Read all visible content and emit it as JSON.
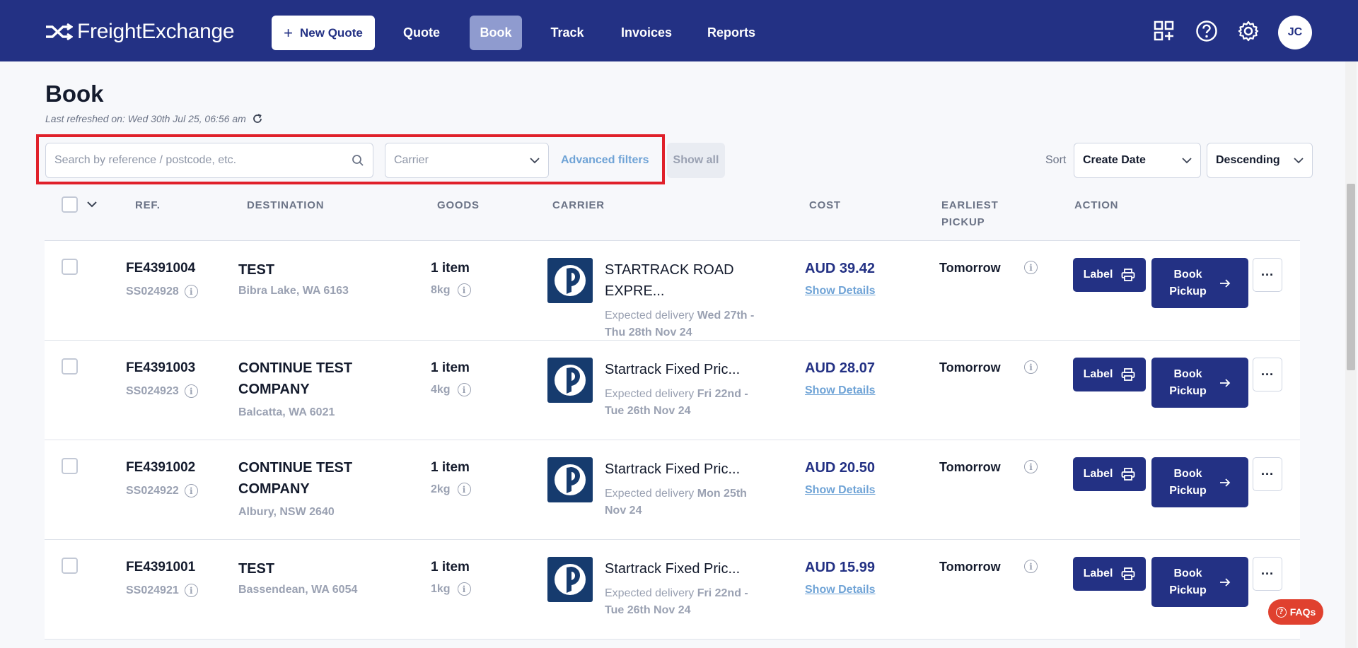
{
  "app": {
    "logo_text": "FreightExchange",
    "user_initials": "JC"
  },
  "nav": {
    "new_quote": "New Quote",
    "items": [
      "Quote",
      "Book",
      "Track",
      "Invoices",
      "Reports"
    ],
    "active": "Book"
  },
  "header": {
    "title": "Book",
    "refreshed": "Last refreshed on: Wed 30th Jul 25, 06:56 am"
  },
  "filters": {
    "search_placeholder": "Search by reference / postcode, etc.",
    "carrier_placeholder": "Carrier",
    "advanced": "Advanced filters",
    "show_all": "Show all",
    "sort_label": "Sort",
    "sort_by": "Create Date",
    "sort_order": "Descending"
  },
  "table": {
    "columns": [
      "REF.",
      "DESTINATION",
      "GOODS",
      "CARRIER",
      "COST",
      "EARLIEST",
      "PICKUP",
      "ACTION"
    ],
    "rows": [
      {
        "ref": "FE4391004",
        "sub_ref": "SS024928",
        "dest_name": [
          "TEST"
        ],
        "dest_loc": "Bibra Lake, WA 6163",
        "goods": "1 item",
        "weight": "8kg",
        "carrier": [
          "STARTRACK ROAD",
          "EXPRE..."
        ],
        "expected_prefix": "Expected delivery ",
        "expected_date": "Wed 27th - Thu 28th Nov 24",
        "cost": "AUD 39.42",
        "pickup": "Tomorrow"
      },
      {
        "ref": "FE4391003",
        "sub_ref": "SS024923",
        "dest_name": [
          "CONTINUE TEST",
          "COMPANY"
        ],
        "dest_loc": "Balcatta, WA 6021",
        "goods": "1 item",
        "weight": "4kg",
        "carrier": [
          "Startrack Fixed Pric..."
        ],
        "expected_prefix": "Expected delivery ",
        "expected_date": "Fri 22nd - Tue 26th Nov 24",
        "cost": "AUD 28.07",
        "pickup": "Tomorrow"
      },
      {
        "ref": "FE4391002",
        "sub_ref": "SS024922",
        "dest_name": [
          "CONTINUE TEST",
          "COMPANY"
        ],
        "dest_loc": "Albury, NSW 2640",
        "goods": "1 item",
        "weight": "2kg",
        "carrier": [
          "Startrack Fixed Pric..."
        ],
        "expected_prefix": "Expected delivery ",
        "expected_date": "Mon 25th Nov 24",
        "cost": "AUD 20.50",
        "pickup": "Tomorrow"
      },
      {
        "ref": "FE4391001",
        "sub_ref": "SS024921",
        "dest_name": [
          "TEST"
        ],
        "dest_loc": "Bassendean, WA 6054",
        "goods": "1 item",
        "weight": "1kg",
        "carrier": [
          "Startrack Fixed Pric..."
        ],
        "expected_prefix": "Expected delivery ",
        "expected_date": "Fri 22nd - Tue 26th Nov 24",
        "cost": "AUD 15.99",
        "pickup": "Tomorrow"
      }
    ],
    "show_details": "Show Details",
    "btn_label": "Label",
    "btn_book": [
      "Book",
      "Pickup"
    ],
    "btn_more": "···"
  },
  "faqs": "FAQs",
  "colors": {
    "nav_bg": "#233184",
    "accent": "#233184",
    "link": "#6fa3d6",
    "highlight": "#e0202a",
    "faqs": "#e0412f"
  }
}
